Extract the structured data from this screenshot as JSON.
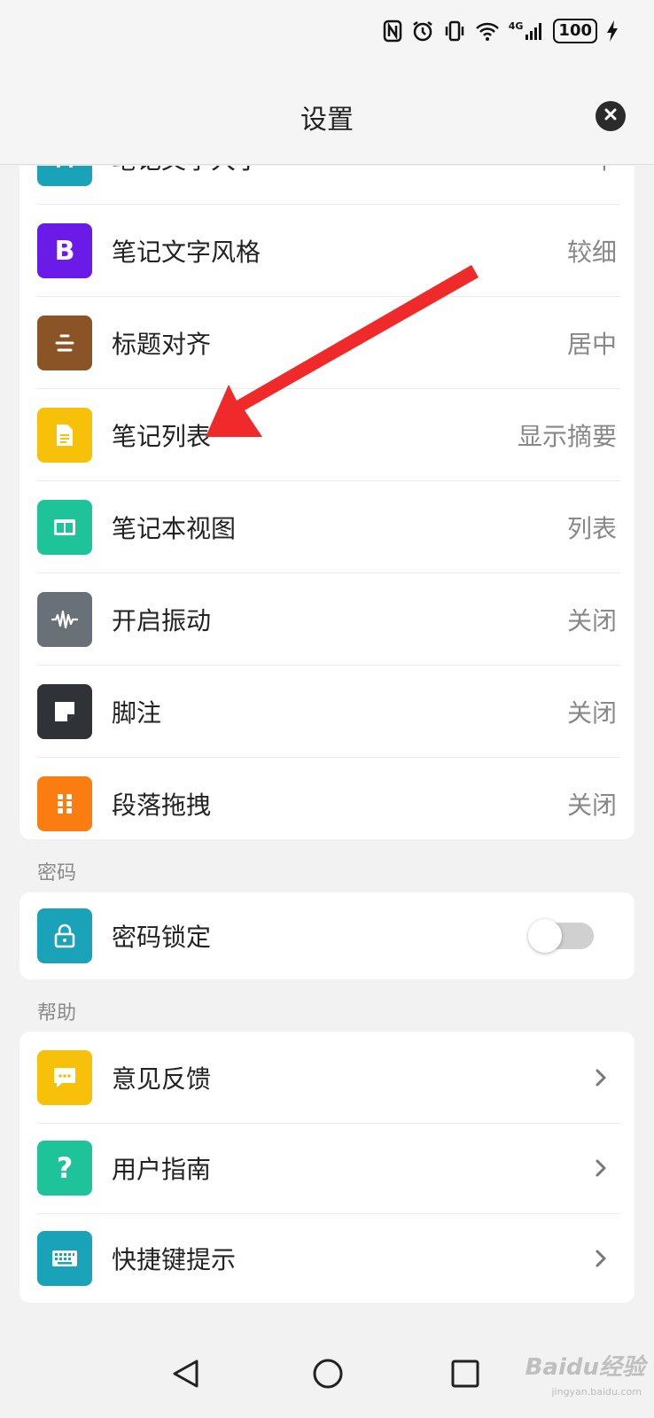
{
  "status": {
    "battery": "100",
    "network": "4G"
  },
  "header": {
    "title": "设置"
  },
  "display_items": [
    {
      "label": "笔记文字大小",
      "value": "中",
      "icon": "text-size-icon",
      "color": "#1aa3b8"
    },
    {
      "label": "笔记文字风格",
      "value": "较细",
      "icon": "bold-icon",
      "color": "#6a1be8"
    },
    {
      "label": "标题对齐",
      "value": "居中",
      "icon": "align-center-icon",
      "color": "#8a5426"
    },
    {
      "label": "笔记列表",
      "value": "显示摘要",
      "icon": "document-icon",
      "color": "#f7c10a"
    },
    {
      "label": "笔记本视图",
      "value": "列表",
      "icon": "layout-icon",
      "color": "#1ec39a"
    },
    {
      "label": "开启振动",
      "value": "关闭",
      "icon": "waveform-icon",
      "color": "#6a7078"
    },
    {
      "label": "脚注",
      "value": "关闭",
      "icon": "note-icon",
      "color": "#2f3236"
    },
    {
      "label": "段落拖拽",
      "value": "关闭",
      "icon": "drag-handle-icon",
      "color": "#fb7d12"
    }
  ],
  "password_section": {
    "title": "密码",
    "item": {
      "label": "密码锁定",
      "icon": "lock-icon",
      "color": "#1aa3b8",
      "enabled": false
    }
  },
  "help_section": {
    "title": "帮助",
    "items": [
      {
        "label": "意见反馈",
        "icon": "chat-icon",
        "color": "#f7c10a"
      },
      {
        "label": "用户指南",
        "icon": "question-icon",
        "color": "#1ec39a"
      },
      {
        "label": "快捷键提示",
        "icon": "keyboard-icon",
        "color": "#1aa3b8"
      }
    ]
  },
  "watermark": {
    "text": "Baidu经验",
    "sub": "jingyan.baidu.com"
  },
  "annotation_color": "#f02a2a"
}
